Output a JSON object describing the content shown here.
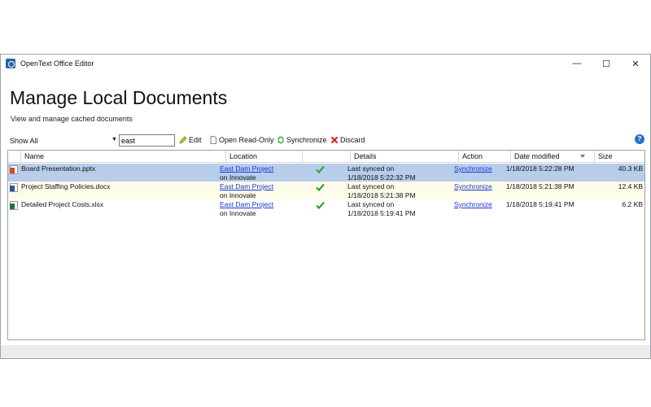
{
  "window": {
    "title": "OpenText Office Editor",
    "controls": {
      "minimize": "—",
      "maximize": "☐",
      "close": "✕"
    }
  },
  "page": {
    "heading": "Manage Local Documents",
    "subheading": "View and manage cached documents"
  },
  "toolbar": {
    "filter_label": "Show All",
    "search_value": "east",
    "edit_label": "Edit",
    "open_readonly_label": "Open Read-Only",
    "synchronize_label": "Synchronize",
    "discard_label": "Discard",
    "help_glyph": "?"
  },
  "columns": {
    "name": "Name",
    "location": "Location",
    "details": "Details",
    "action": "Action",
    "date_modified": "Date modified",
    "size": "Size"
  },
  "rows": [
    {
      "name": "Board Presentation.pptx",
      "file_type": "pptx",
      "location_link": "East Dam Project",
      "location_sub": "on Innovate",
      "details_line1": "Last synced on",
      "details_line2": "1/18/2018 5:22:32 PM",
      "action": "Synchronize",
      "date_modified": "1/18/2018 5:22:28 PM",
      "size": "40.3 KB",
      "selected": true
    },
    {
      "name": "Project Staffing Policies.docx",
      "file_type": "docx",
      "location_link": "East Dam Project",
      "location_sub": "on Innovate",
      "details_line1": "Last synced on",
      "details_line2": "1/18/2018 5:21:38 PM",
      "action": "Synchronize",
      "date_modified": "1/18/2018 5:21:38 PM",
      "size": "12.4 KB",
      "selected": false
    },
    {
      "name": "Detailed Project Costs.xlsx",
      "file_type": "xlsx",
      "location_link": "East Dam Project",
      "location_sub": "on Innovate",
      "details_line1": "Last synced on",
      "details_line2": "1/18/2018 5:19:41 PM",
      "action": "Synchronize",
      "date_modified": "1/18/2018 5:19:41 PM",
      "size": "6.2 KB",
      "selected": false
    }
  ],
  "colors": {
    "selected_row": "#b7cdea",
    "alt_row": "#fdfbea",
    "link": "#1a36d6",
    "pptx": "#d24726",
    "docx": "#2b579a",
    "xlsx": "#217346",
    "sync_check": "#2ea52e"
  }
}
